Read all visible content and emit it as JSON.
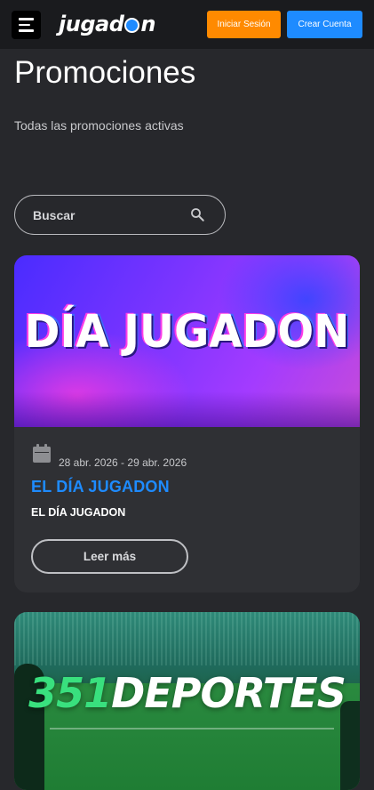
{
  "header": {
    "logo_text_before": "jugad",
    "logo_text_after": "n",
    "login_label": "Iniciar Sesión",
    "signup_label": "Crear Cuenta"
  },
  "page": {
    "title": "Promociones",
    "subtitle": "Todas las promociones activas"
  },
  "search": {
    "placeholder": "Buscar"
  },
  "promotions": [
    {
      "banner_text": "DÍA JUGADON",
      "date_range": "28 abr. 2026 - 29 abr. 2026",
      "title": "EL DÍA JUGADON",
      "description": "EL DÍA JUGADON",
      "cta_label": "Leer más"
    },
    {
      "banner_number": "351",
      "banner_word": "DEPORTES"
    }
  ],
  "colors": {
    "accent_blue": "#1e8bff",
    "accent_orange": "#ff8a00",
    "background": "#27282c",
    "card": "#2f3034"
  }
}
